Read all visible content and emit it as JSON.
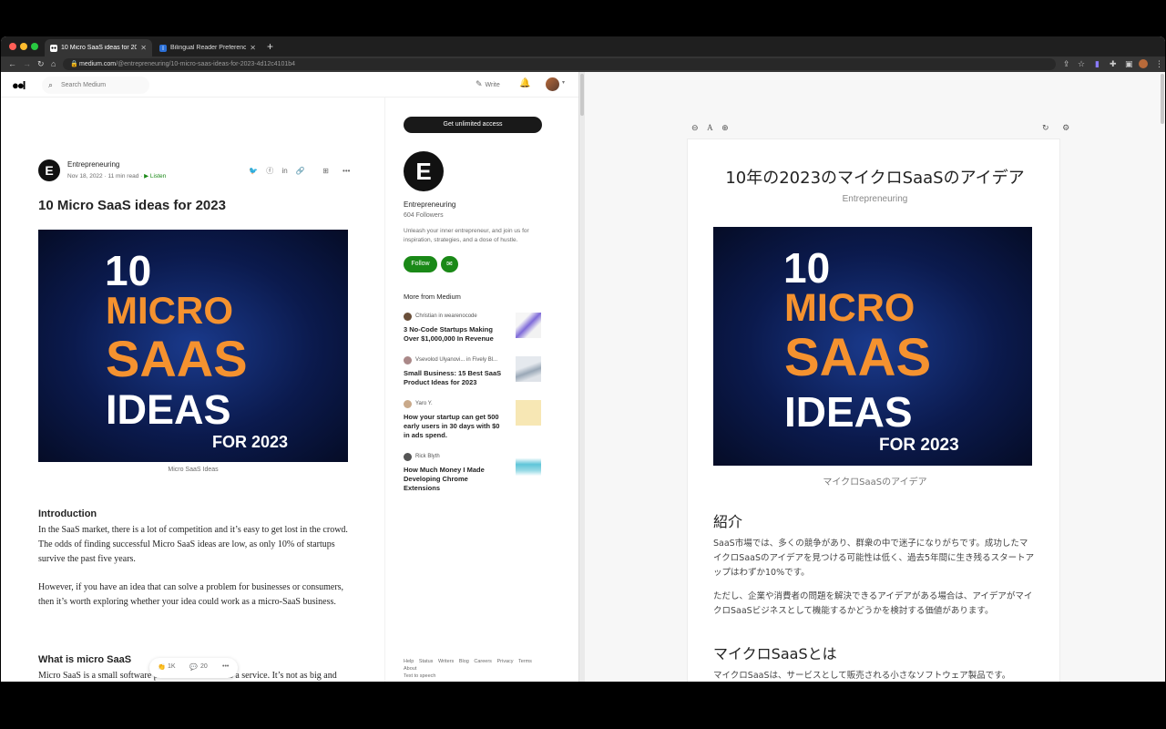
{
  "browser": {
    "tabs": [
      {
        "title": "10 Micro SaaS ideas for 2023",
        "close": "✕"
      },
      {
        "title": "Bilingual Reader Preferences",
        "close": "✕"
      }
    ],
    "new_tab": "+",
    "url_domain": "medium.com",
    "url_path": "/@entrepreneuring/10-micro-saas-ideas-for-2023-4d12c4101b4",
    "colors": {
      "tabstrip": "#1f1f1f",
      "toolbar": "#353535",
      "close": "#ff5f57",
      "minimize": "#febc2e",
      "zoom": "#28c840"
    }
  },
  "medium": {
    "logo": "●●I",
    "search_placeholder": "Search Medium",
    "write_label": "Write",
    "article": {
      "author": "Entrepreneuring",
      "date": "Nov 18, 2022",
      "read_time": "11 min read",
      "listen": "Listen",
      "title": "10 Micro SaaS ideas for 2023",
      "hero": {
        "line1": "10",
        "line2": "MICRO",
        "line3": "SAAS",
        "line4": "IDEAS",
        "line5": "FOR 2023"
      },
      "caption": "Micro SaaS Ideas",
      "intro_heading": "Introduction",
      "intro_p1": "In the SaaS market, there is a lot of competition and it’s easy to get lost in the crowd. The odds of finding successful Micro SaaS ideas are low, as only 10% of startups survive the past five years.",
      "intro_p2": "However, if you have an idea that can solve a problem for businesses or consumers, then it’s worth exploring whether your idea could work as a micro-SaaS business.",
      "what_heading": "What is micro SaaS",
      "what_p1": "Micro SaaS is a small software product that is sold as a service. It’s not as big and complex as Microsoft Excel, but it performs a specific task or solves a particular problem for indi... aS can be delivered online to the cloud."
    },
    "clapbar": {
      "claps": "1K",
      "comments": "20",
      "more": "•••"
    },
    "sidebar": {
      "unlimited_button": "Get unlimited access",
      "publication": "Entrepreneuring",
      "followers": "604 Followers",
      "description": "Unleash your inner entrepreneur, and join us for inspiration, strategies, and a dose of hustle.",
      "follow_button": "Follow",
      "more_title": "More from Medium",
      "recommendations": [
        {
          "meta": "Christian  in  wearenocode",
          "title": "3 No-Code Startups Making Over $1,000,000 In Revenue"
        },
        {
          "meta": "Vsevolod Ulyanovi...  in  Fively Bl...",
          "title": "Small Business: 15 Best SaaS Product Ideas for 2023"
        },
        {
          "meta": "Yaro Y.",
          "title": "How your startup can get 500 early users in 30 days with $0 in ads spend."
        },
        {
          "meta": "Rick Blyth",
          "title": "How Much Money I Made Developing Chrome Extensions"
        }
      ],
      "footer_links": [
        "Help",
        "Status",
        "Writers",
        "Blog",
        "Careers",
        "Privacy",
        "Terms",
        "About",
        "Text to speech"
      ]
    }
  },
  "reader": {
    "title": "10年の2023のマイクロSaaSのアイデア",
    "subtitle": "Entrepreneuring",
    "caption": "マイクロSaaSのアイデア",
    "h_intro": "紹介",
    "p1": "SaaS市場では、多くの競争があり、群衆の中で迷子になりがちです。成功したマイクロSaaSのアイデアを見つける可能性は低く、過去5年間に生き残るスタートアップはわずか10%です。",
    "p2": "ただし、企業や消費者の問題を解決できるアイデアがある場合は、アイデアがマイクロSaaSビジネスとして機能するかどうかを検討する価値があります。",
    "h_what": "マイクロSaaSとは",
    "p3": "マイクロSaaSは、サービスとして販売される小さなソフトウェア製品です。"
  }
}
